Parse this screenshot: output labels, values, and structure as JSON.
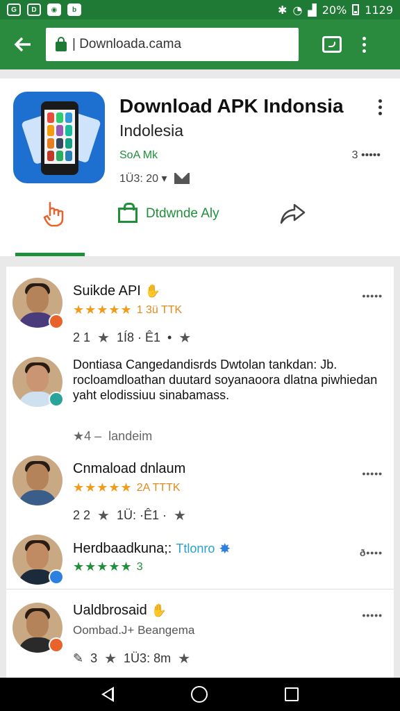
{
  "status_bar": {
    "battery": "20%",
    "time": "1129",
    "left_icons": [
      "sync-icon",
      "gallery-icon",
      "notification-icon",
      "b-icon"
    ]
  },
  "browser": {
    "url": "| Downloada.cama",
    "back_icon": "back-arrow-icon",
    "tabs_icon": "tabs-icon",
    "menu_icon": "overflow-menu-icon"
  },
  "app": {
    "title": "Download APK Indonsia",
    "developer": "Indolesia",
    "size": "SoA Mk",
    "meta": "1Ü3: 20 ▾",
    "right_meta": "3 •••••",
    "install_label": "Dtdwnde Aly",
    "colors": {
      "accent": "#2a8a3d",
      "icon_bg": "#1d6fd0",
      "star": "#f29b1a"
    }
  },
  "reviews": [
    {
      "name": "Suikde API",
      "stars": "★★★★★",
      "count": "1 3ü TTK",
      "meta_left": "2 1",
      "meta_mid": "1Í8 · Ê1",
      "more": "•••••",
      "star_color": "orange",
      "badge": "#e8622a",
      "shirt": "#4a3b7a"
    },
    {
      "name": "",
      "body": "Dontiasa Cangedandisrds Dwtolan tankdan: Jb. rocloamdloathan duutard soyanaoora dlatna piwhiedan yaht elodissiuu sinabamass.",
      "meta_left": "★4 –",
      "meta_mid": "landeim",
      "badge": "#2aa39a",
      "shirt": "#cfe0ef"
    },
    {
      "name": "Cnmaload dnlaum",
      "stars": "★★★★★",
      "count": "2A TTTK",
      "meta_left": "2 2",
      "meta_mid": "1Ü: ·Ê1 ·",
      "more": "•••••",
      "star_color": "orange",
      "badge": "",
      "shirt": "#3a5d8a"
    },
    {
      "name": "Herdbaadkuna;:",
      "name_extra": "Ttlonro",
      "stars": "★★★★★",
      "count": "3",
      "more": "ð••••",
      "star_color": "green",
      "badge": "#2d7fe0",
      "shirt": "#1c2b3c"
    },
    {
      "name": "Ualdbrosaid",
      "sub": "Oombad.J+ Beangema",
      "meta_left": "3",
      "meta_mid": "1Ü3: 8m",
      "more": "•••••",
      "badge": "#e8622a",
      "shirt": "#2a2a2a"
    }
  ],
  "navbar": {
    "back": "nav-back-icon",
    "home": "nav-home-icon",
    "recent": "nav-recent-icon"
  }
}
